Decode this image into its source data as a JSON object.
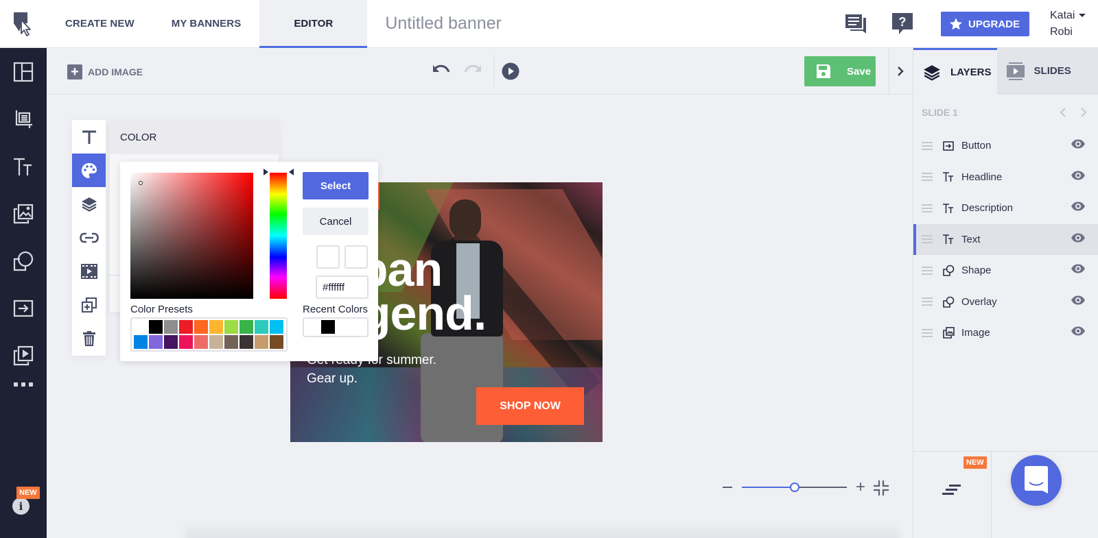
{
  "topbar": {
    "nav": [
      {
        "label": "CREATE NEW"
      },
      {
        "label": "MY BANNERS"
      },
      {
        "label": "EDITOR",
        "active": true
      }
    ],
    "banner_title": "Untitled banner",
    "upgrade_label": "UPGRADE",
    "user_first": "Katai",
    "user_last": "Robi"
  },
  "sidebar": {
    "items": [
      {
        "icon": "layout-icon"
      },
      {
        "icon": "crop-icon"
      },
      {
        "icon": "text-icon"
      },
      {
        "icon": "images-icon"
      },
      {
        "icon": "shapes-icon"
      },
      {
        "icon": "button-icon"
      },
      {
        "icon": "animation-icon"
      }
    ],
    "new_badge": "NEW"
  },
  "toolbar": {
    "add_image_label": "ADD IMAGE",
    "save_label": "Save"
  },
  "properties": {
    "items": [
      "text-icon",
      "palette-icon",
      "layers-icon",
      "link-icon",
      "film-icon",
      "duplicate-icon",
      "trash-icon"
    ],
    "active_index": 1,
    "panel_title": "COLOR"
  },
  "color_picker": {
    "select_label": "Select",
    "cancel_label": "Cancel",
    "hex_value": "#ffffff",
    "presets_label": "Color Presets",
    "recent_label": "Recent Colors",
    "hue": "#ff0000",
    "presets": [
      "#ffffff",
      "#000000",
      "#8e8e8e",
      "#ec1c24",
      "#fd6720",
      "#fbb52f",
      "#9cdc45",
      "#37b34a",
      "#2dcbbd",
      "#00bff3",
      "#0083e1",
      "#8266dc",
      "#461462",
      "#ed145b",
      "#ee6c68",
      "#c7b299",
      "#736357",
      "#3b3233",
      "#c69c6d",
      "#754c24"
    ],
    "recent": [
      "#000000"
    ],
    "accent": "#5168de"
  },
  "banner": {
    "headline_line1": "Urban",
    "headline_line2": "Legend.",
    "headline_visible1": "ban",
    "headline_visible2": "gend.",
    "description_line1": "Get ready for summer.",
    "description_line2": "Gear up.",
    "cta": "SHOP NOW",
    "cta_color": "#fe5e36"
  },
  "zoom": {
    "level": 0.5
  },
  "right_panel": {
    "tabs": [
      {
        "label": "LAYERS",
        "active": true
      },
      {
        "label": "SLIDES"
      }
    ],
    "slide_label": "SLIDE 1",
    "layers": [
      {
        "name": "Button",
        "icon": "button-icon"
      },
      {
        "name": "Headline",
        "icon": "text-icon"
      },
      {
        "name": "Description",
        "icon": "text-icon"
      },
      {
        "name": "Text",
        "icon": "text-icon",
        "active": true
      },
      {
        "name": "Shape",
        "icon": "shape-icon"
      },
      {
        "name": "Overlay",
        "icon": "shape-icon"
      },
      {
        "name": "Image",
        "icon": "image-icon"
      }
    ],
    "new_badge": "NEW"
  }
}
